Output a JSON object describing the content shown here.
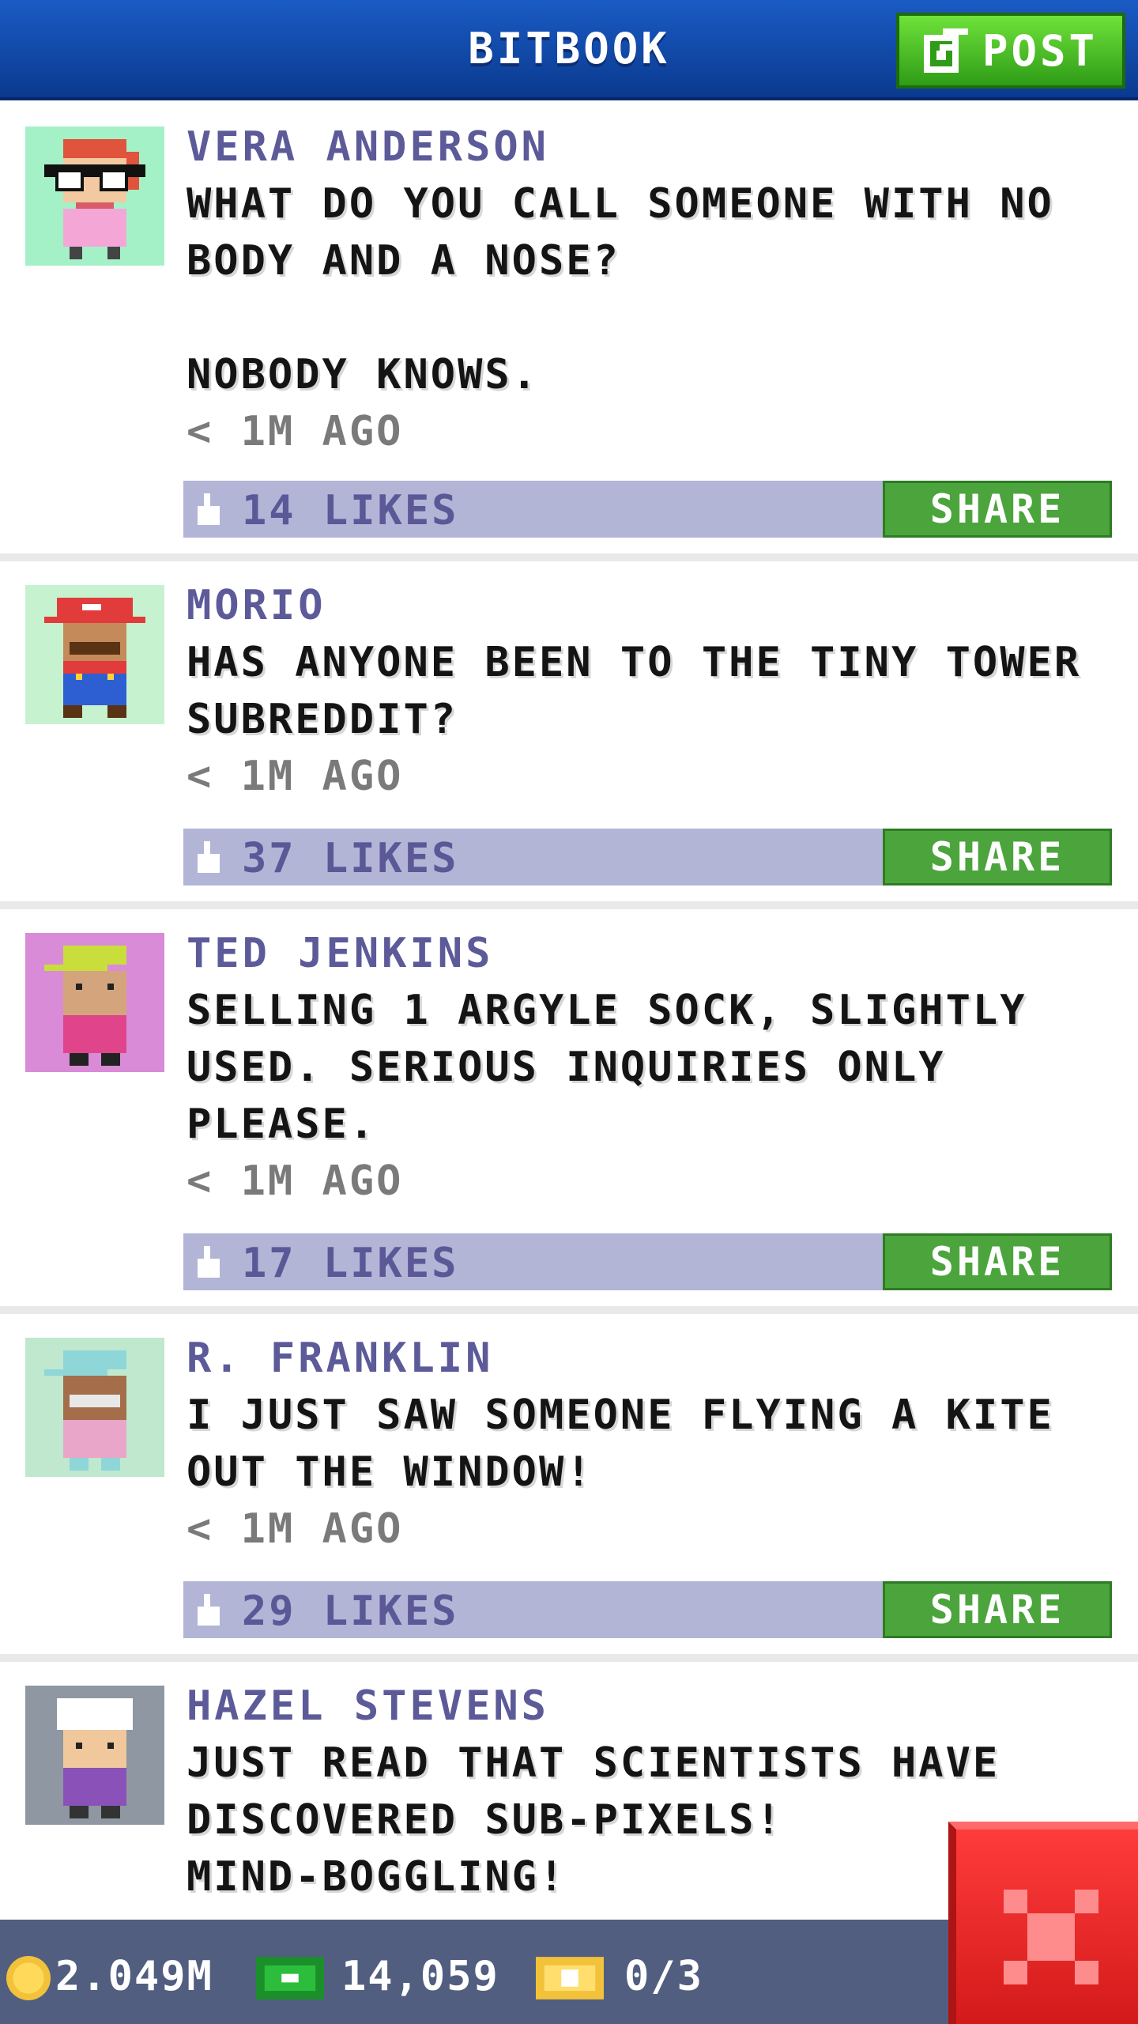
{
  "header": {
    "title": "BITBOOK",
    "post_label": "POST"
  },
  "colors": {
    "header": "#1a5bc4",
    "accent_green": "#4ca43d",
    "likes_bar": "#b3b5d7",
    "author": "#5c5a98",
    "close_red": "#ff3b3b"
  },
  "posts": [
    {
      "author": "VERA ANDERSON",
      "message": "WHAT DO YOU CALL SOMEONE WITH NO\nBODY AND A NOSE?\n\nNOBODY KNOWS.",
      "time": "< 1M AGO",
      "likes": "14 LIKES",
      "share_label": "SHARE",
      "avatar_bg": "#a4f1c8"
    },
    {
      "author": "MORIO",
      "message": "HAS ANYONE BEEN TO THE TINY TOWER\nSUBREDDIT?",
      "time": "< 1M AGO",
      "likes": "37 LIKES",
      "share_label": "SHARE",
      "avatar_bg": "#c6f2cf"
    },
    {
      "author": "TED JENKINS",
      "message": "SELLING 1 ARGYLE SOCK, SLIGHTLY\nUSED. SERIOUS INQUIRIES ONLY\nPLEASE.",
      "time": "< 1M AGO",
      "likes": "17 LIKES",
      "share_label": "SHARE",
      "avatar_bg": "#d98bd7"
    },
    {
      "author": "R. FRANKLIN",
      "message": "I JUST SAW SOMEONE FLYING A KITE\nOUT THE WINDOW!",
      "time": "< 1M AGO",
      "likes": "29 LIKES",
      "share_label": "SHARE",
      "avatar_bg": "#bfe8cf"
    },
    {
      "author": "HAZEL STEVENS",
      "message": "JUST READ THAT SCIENTISTS HAVE\nDISCOVERED SUB-PIXELS!\nMIND-BOGGLING!",
      "time": "",
      "likes": "",
      "share_label": "",
      "avatar_bg": "#8f97a3"
    }
  ],
  "footer": {
    "coins": "2.049M",
    "bux": "14,059",
    "tickets": "0/3"
  }
}
